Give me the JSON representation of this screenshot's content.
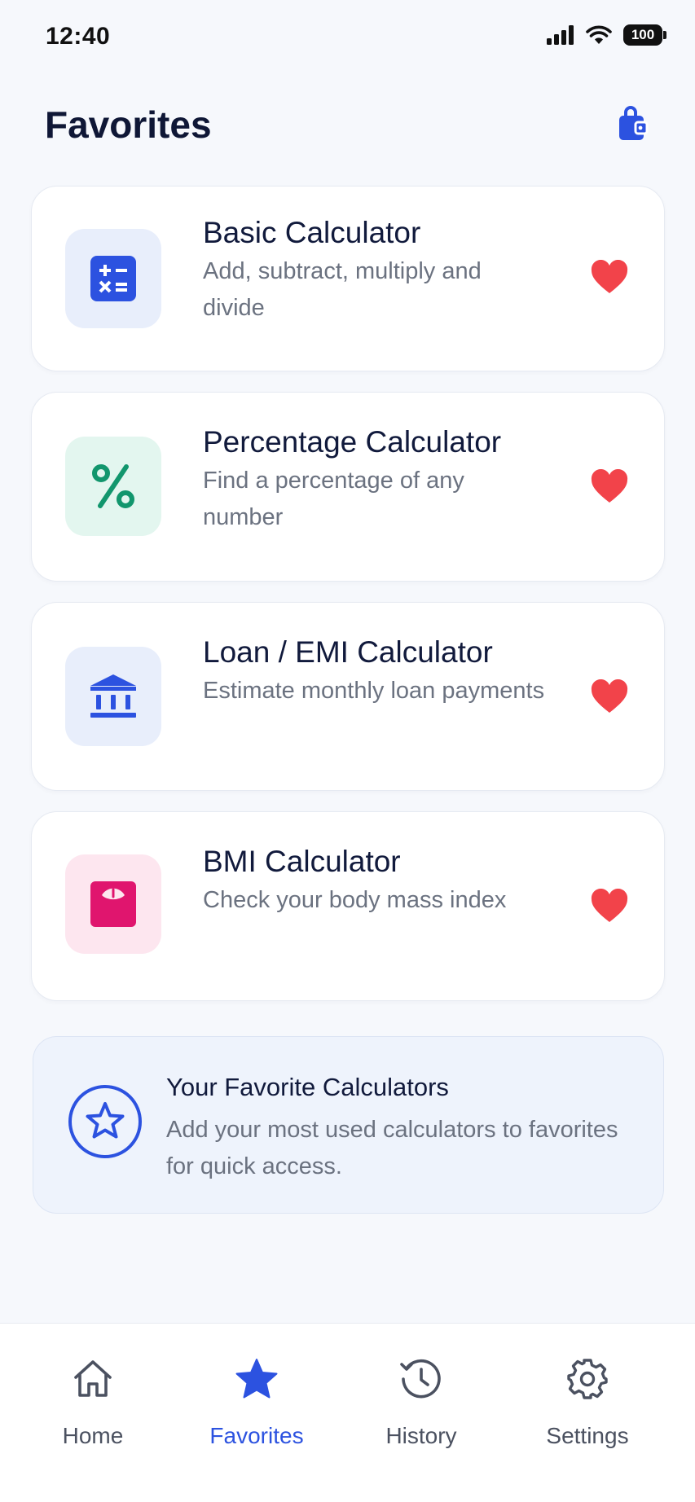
{
  "status_bar": {
    "time": "12:40",
    "battery": "100",
    "icons": [
      "signal-icon",
      "wifi-icon",
      "battery-icon"
    ]
  },
  "header": {
    "title": "Favorites",
    "action_icon": "wallet-icon"
  },
  "favorites": [
    {
      "title": "Basic Calculator",
      "description": "Add, subtract, multiply and divide",
      "icon": "calculator-icon",
      "icon_bg": "#e8eefb",
      "icon_color": "#2c52e0",
      "favorited": true
    },
    {
      "title": "Percentage Calculator",
      "description": "Find a percentage of any number",
      "icon": "percent-icon",
      "icon_bg": "#e3f6ef",
      "icon_color": "#12966d",
      "favorited": true
    },
    {
      "title": "Loan / EMI Calculator",
      "description": "Estimate monthly loan payments",
      "icon": "bank-icon",
      "icon_bg": "#e8eefb",
      "icon_color": "#2c52e0",
      "favorited": true
    },
    {
      "title": "BMI Calculator",
      "description": "Check your body mass index",
      "icon": "scale-icon",
      "icon_bg": "#fde6ef",
      "icon_color": "#e0156e",
      "favorited": true
    }
  ],
  "info": {
    "title": "Your Favorite Calculators",
    "text": "Add your most used calculators to favorites for quick access.",
    "icon": "star-outline-icon"
  },
  "nav": {
    "items": [
      {
        "label": "Home",
        "icon": "home-icon",
        "active": false
      },
      {
        "label": "Favorites",
        "icon": "star-icon",
        "active": true
      },
      {
        "label": "History",
        "icon": "history-icon",
        "active": false
      },
      {
        "label": "Settings",
        "icon": "gear-icon",
        "active": false
      }
    ]
  },
  "colors": {
    "accent": "#2c52e0",
    "heart": "#f2434a",
    "background": "#f6f8fc"
  }
}
